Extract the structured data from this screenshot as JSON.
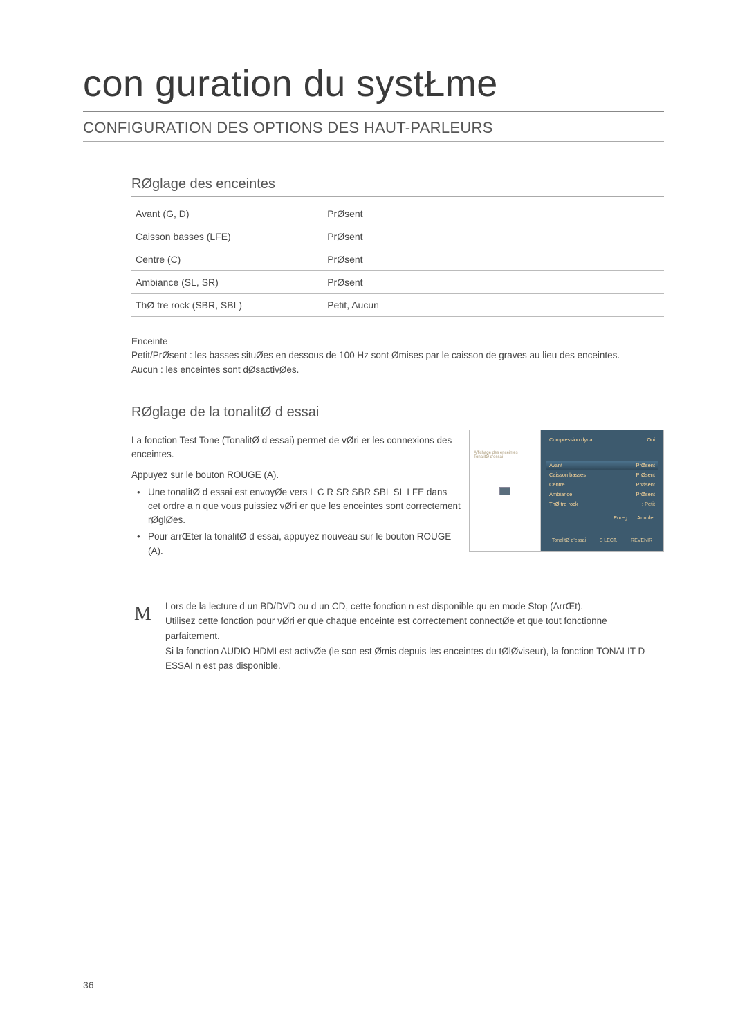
{
  "title": "con guration du systŁme",
  "section_title": "CONFIGURATION DES OPTIONS DES HAUT-PARLEURS",
  "speaker_settings": {
    "title": "RØglage des enceintes",
    "rows": [
      {
        "label": "Avant (G, D)",
        "value": "PrØsent"
      },
      {
        "label": "Caisson basses (LFE)",
        "value": "PrØsent"
      },
      {
        "label": "Centre (C)",
        "value": "PrØsent"
      },
      {
        "label": "Ambiance (SL, SR)",
        "value": "PrØsent"
      },
      {
        "label": "ThØ tre rock (SBR, SBL)",
        "value": "Petit, Aucun"
      }
    ],
    "desc": {
      "heading": "Enceinte",
      "line1": "Petit/PrØsent : les basses situØes en dessous de 100 Hz sont Ømises par le caisson de graves au lieu des enceintes.",
      "line2": "Aucun : les enceintes sont dØsactivØes."
    }
  },
  "testtone": {
    "title": "RØglage de la tonalitØ d essai",
    "intro": "La fonction Test Tone (TonalitØ d essai) permet de vØri er les connexions des enceintes.",
    "press": "Appuyez sur le bouton ROUGE (A).",
    "bullet1": "Une tonalitØ d essai est envoyØe vers L   C   R   SR   SBR   SBL   SL   LFE dans cet ordre a n que vous puissiez vØri er que les enceintes sont correctement rØglØes.",
    "bullet2": "Pour arrŒter la tonalitØ d essai, appuyez   nouveau sur le bouton ROUGE (A)."
  },
  "screenshot": {
    "top_left": "Compression dyna",
    "top_right": ": Oui",
    "leftmenu": {
      "item1": "Affichage des enceintes",
      "item2": "TonalitØ d'essai"
    },
    "rows": [
      {
        "l": "Avant",
        "r": ": PrØsent"
      },
      {
        "l": "Caisson basses",
        "r": ": PrØsent"
      },
      {
        "l": "Centre",
        "r": ": PrØsent"
      },
      {
        "l": "Ambiance",
        "r": ": PrØsent"
      },
      {
        "l": "ThØ tre rock",
        "r": ": Petit"
      }
    ],
    "footer_actions": {
      "a": "Enreg.",
      "b": "Annuler"
    },
    "footer_nav": {
      "l": "TonalitØ d'essai",
      "m": "S LECT.",
      "r": "REVENIR"
    }
  },
  "note": {
    "icon": "M",
    "line1": "Lors de la lecture d un BD/DVD ou d un CD, cette fonction n est disponible qu en mode Stop (ArrŒt).",
    "line2": "Utilisez cette fonction pour vØri er que chaque enceinte est correctement connectØe et que tout fonctionne parfaitement.",
    "line3": "Si la fonction AUDIO HDMI est activØe (le son est Ømis depuis les enceintes du tØlØviseur), la fonction TONALIT  D ESSAI n est pas disponible."
  },
  "page_number": "36"
}
